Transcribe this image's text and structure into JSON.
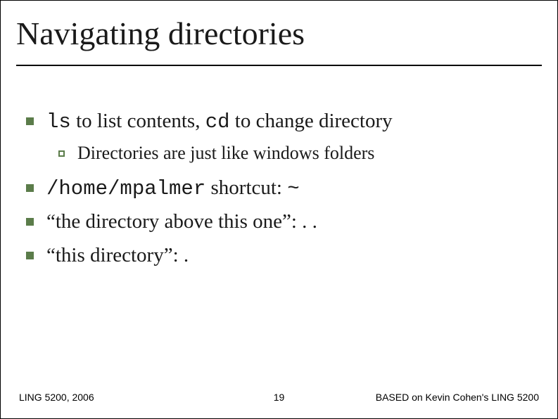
{
  "title": "Navigating directories",
  "bullets": {
    "b1_code1": "ls",
    "b1_mid": " to list contents, ",
    "b1_code2": "cd",
    "b1_end": " to change directory",
    "sub1": "Directories are just like windows folders",
    "b2_code": "/home/mpalmer",
    "b2_mid": " shortcut: ",
    "b2_sym": "~",
    "b3": "“the directory above this one”: . .",
    "b4": "“this directory”: ."
  },
  "footer": {
    "left": "LING 5200, 2006",
    "center": "19",
    "right": "BASED on Kevin Cohen's LING 5200"
  }
}
